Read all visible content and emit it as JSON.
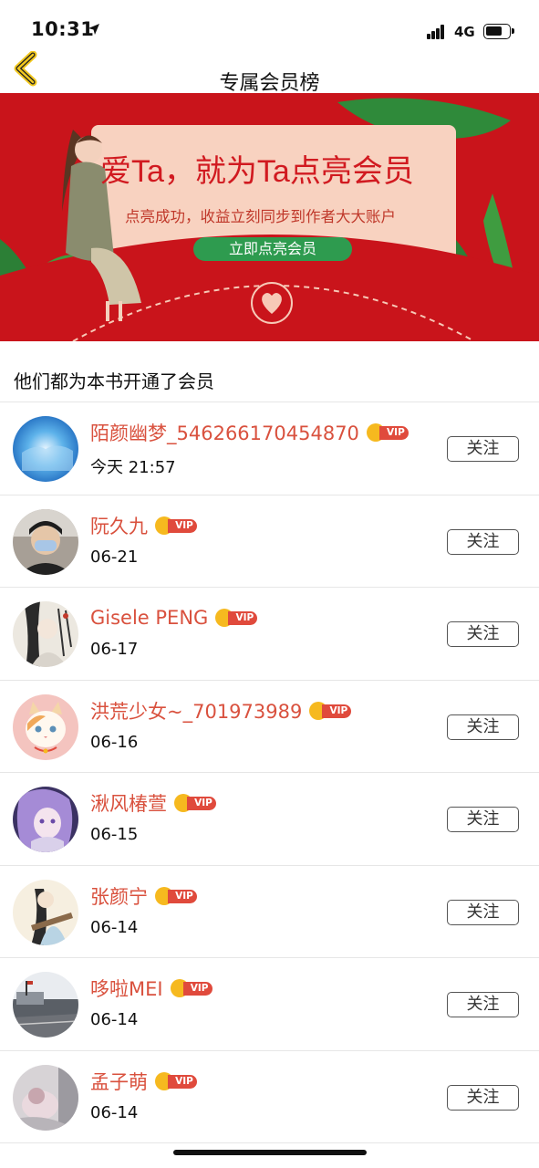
{
  "status_bar": {
    "time": "10:31",
    "network": "4G"
  },
  "nav": {
    "title": "专属会员榜",
    "back_icon": "chevron-left-icon"
  },
  "banner": {
    "headline": "爱Ta，就为Ta点亮会员",
    "subtitle": "点亮成功，收益立刻同步到作者大大账户",
    "cta_label": "立即点亮会员",
    "colors": {
      "background": "#c9141b",
      "card": "#f8d2c0",
      "cta": "#2e9b4f"
    }
  },
  "section": {
    "title": "他们都为本书开通了会员"
  },
  "vip_label": "VIP",
  "follow_label": "关注",
  "members": [
    {
      "name": "陌颜幽梦_546266170454870",
      "date": "今天 21:57",
      "avatar": "blue-sky-avatar"
    },
    {
      "name": "阮久九",
      "date": "06-21",
      "avatar": "masked-person-avatar"
    },
    {
      "name": "Gisele PENG",
      "date": "06-17",
      "avatar": "anime-ink-avatar"
    },
    {
      "name": "洪荒少女~_701973989",
      "date": "06-16",
      "avatar": "cat-avatar"
    },
    {
      "name": "湫风椿萱",
      "date": "06-15",
      "avatar": "purple-anime-avatar"
    },
    {
      "name": "张颜宁",
      "date": "06-14",
      "avatar": "guqin-anime-avatar"
    },
    {
      "name": "哆啦MEI",
      "date": "06-14",
      "avatar": "building-photo-avatar"
    },
    {
      "name": "孟子萌",
      "date": "06-14",
      "avatar": "blurry-photo-avatar"
    }
  ],
  "colors": {
    "name": "#d9513e",
    "vip_tag": "#e04a3c",
    "crown": "#f6b91f"
  }
}
